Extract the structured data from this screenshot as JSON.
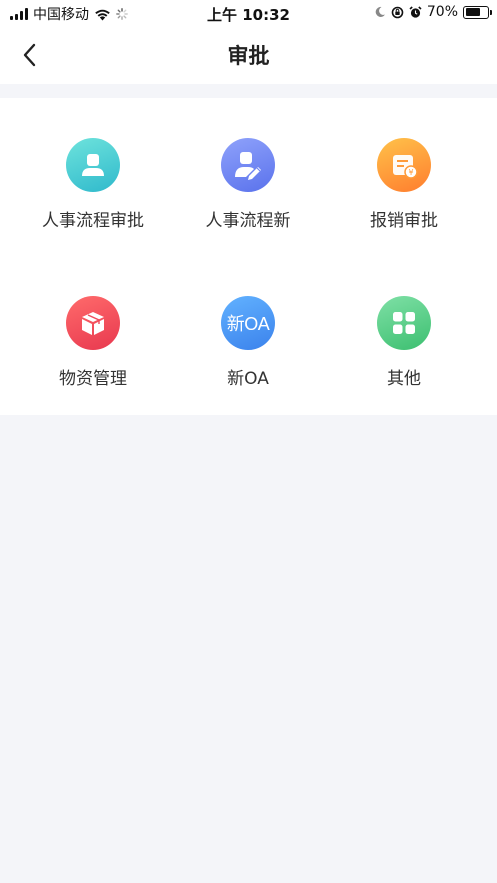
{
  "status_bar": {
    "carrier": "中国移动",
    "time": "上午 10:32",
    "battery_percent": "70%",
    "battery_level": 0.7
  },
  "nav": {
    "title": "审批"
  },
  "grid": {
    "items": [
      {
        "label": "人事流程审批",
        "icon": "person-icon",
        "color": "#39c7cf"
      },
      {
        "label": "人事流程新",
        "icon": "person-edit-icon",
        "color": "#6f86f5"
      },
      {
        "label": "报销审批",
        "icon": "receipt-icon",
        "color": "#ff9b3a"
      },
      {
        "label": "物资管理",
        "icon": "box-icon",
        "color": "#ef4b5c"
      },
      {
        "label": "新OA",
        "icon": "oa-icon",
        "icon_text": "新OA",
        "color": "#4a97f3"
      },
      {
        "label": "其他",
        "icon": "grid-icon",
        "color": "#4fcb82"
      }
    ]
  }
}
